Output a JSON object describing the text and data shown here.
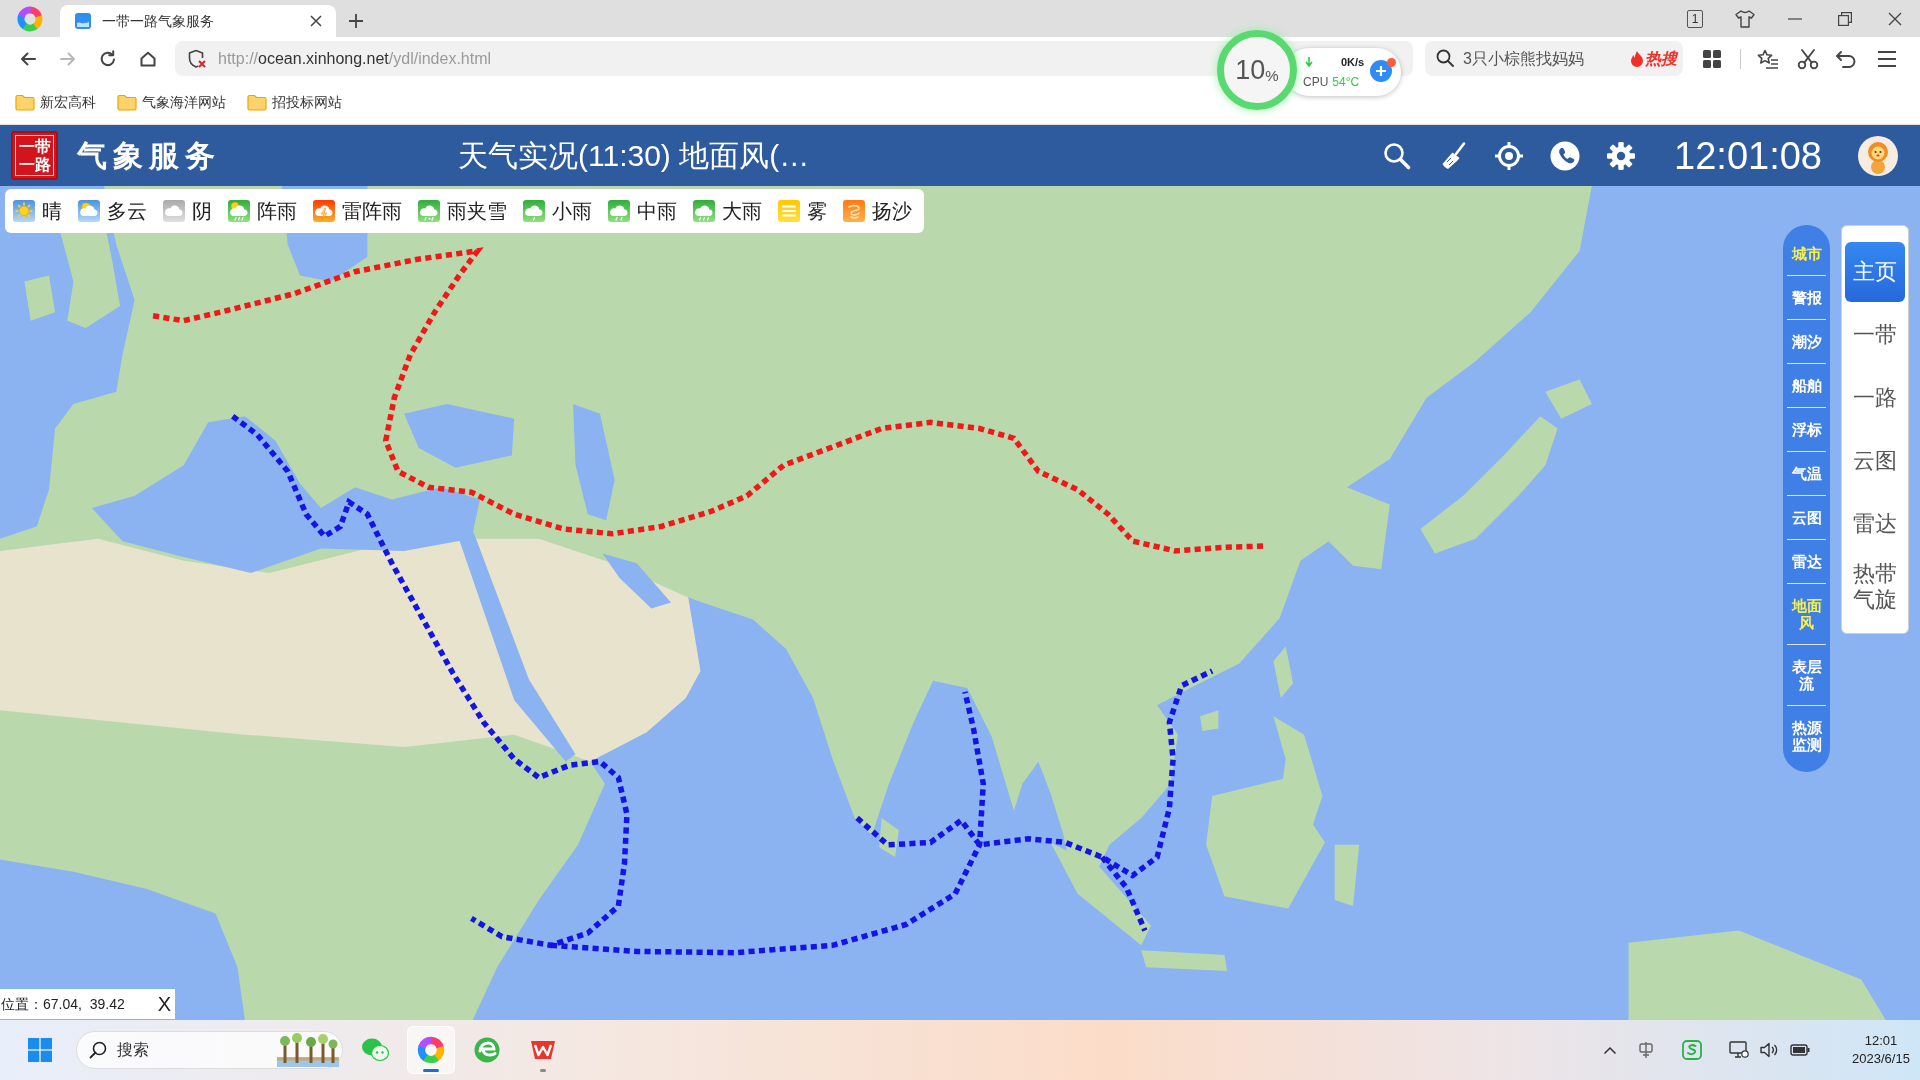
{
  "browser": {
    "tabs": [
      {
        "title": "一带一路气象服务",
        "selected": true
      }
    ],
    "tab_counter": "1",
    "nav_buttons": [
      {
        "kind": "back",
        "disabled": false
      },
      {
        "kind": "forward",
        "disabled": true
      },
      {
        "kind": "reload",
        "disabled": false
      },
      {
        "kind": "home",
        "disabled": false
      }
    ],
    "address": {
      "scheme": "http://",
      "host": "ocean.xinhong.net",
      "path": "/ydl/index.html"
    },
    "monitor": {
      "load_value": "10",
      "load_unit": "%",
      "net_speed": "0K/s",
      "cpu_label": "CPU",
      "cpu_temp": "54°C"
    },
    "search": {
      "placeholder": "3只小棕熊找妈妈",
      "hot_label": "热搜"
    },
    "bookmarks": [
      "新宏高科",
      "气象海洋网站",
      "招投标网站"
    ]
  },
  "app": {
    "logo_lines": [
      "一带",
      "一路"
    ],
    "title": "气象服务",
    "heading": "天气实况(11:30) 地面风(…",
    "clock": "12:01:08",
    "legend": [
      {
        "kind": "sunny",
        "label": "晴"
      },
      {
        "kind": "cloudy",
        "label": "多云"
      },
      {
        "kind": "overcast",
        "label": "阴"
      },
      {
        "kind": "shower",
        "label": "阵雨"
      },
      {
        "kind": "thunder",
        "label": "雷阵雨"
      },
      {
        "kind": "sleet",
        "label": "雨夹雪"
      },
      {
        "kind": "light_rain",
        "label": "小雨"
      },
      {
        "kind": "moderate_rain",
        "label": "中雨"
      },
      {
        "kind": "heavy_rain",
        "label": "大雨"
      },
      {
        "kind": "fog",
        "label": "雾"
      },
      {
        "kind": "sand",
        "label": "扬沙"
      }
    ],
    "layers": [
      {
        "label": "城市",
        "selected": true
      },
      {
        "label": "警报",
        "selected": false
      },
      {
        "label": "潮汐",
        "selected": false
      },
      {
        "label": "船舶",
        "selected": false
      },
      {
        "label": "浮标",
        "selected": false
      },
      {
        "label": "气温",
        "selected": false
      },
      {
        "label": "云图",
        "selected": false
      },
      {
        "label": "雷达",
        "selected": false
      },
      {
        "label": "地面风",
        "selected": true
      },
      {
        "label": "表层流",
        "selected": false
      },
      {
        "label": "热源监测",
        "selected": false
      }
    ],
    "nav": [
      {
        "label": "主页",
        "selected": true
      },
      {
        "label": "一带",
        "selected": false
      },
      {
        "label": "一路",
        "selected": false
      },
      {
        "label": "云图",
        "selected": false
      },
      {
        "label": "雷达",
        "selected": false
      },
      {
        "label": "热带气旋",
        "selected": false
      }
    ],
    "position": {
      "text": "位置：67.04,  39.42",
      "close": "X"
    }
  },
  "taskbar": {
    "search_placeholder": "搜索",
    "apps": [
      {
        "kind": "chat",
        "selected": false,
        "running": false
      },
      {
        "kind": "browser",
        "selected": true,
        "running": true
      },
      {
        "kind": "edge",
        "selected": false,
        "running": false
      },
      {
        "kind": "office",
        "selected": false,
        "running": true
      }
    ],
    "time": "12:01",
    "date": "2023/6/15"
  }
}
